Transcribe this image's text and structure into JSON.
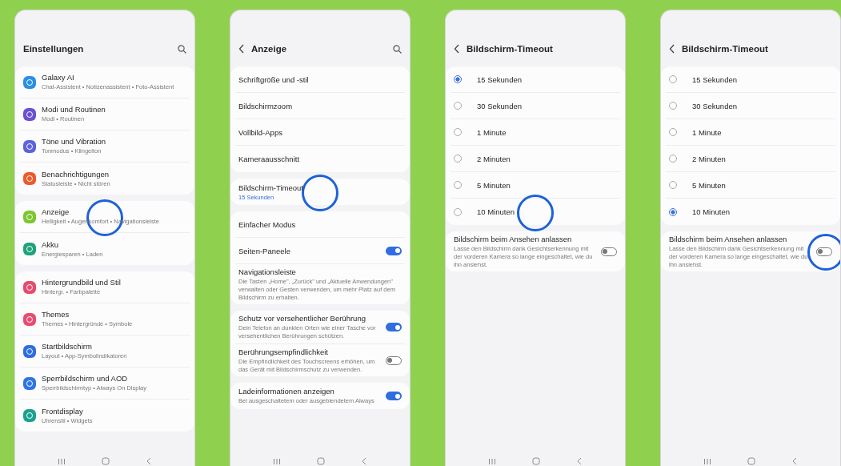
{
  "screens": [
    {
      "header": {
        "title": "Einstellungen",
        "back": false,
        "search": true
      },
      "groups": [
        [
          {
            "kind": "app",
            "color": "#2a8fe8",
            "title": "Galaxy AI",
            "subtitle": "Chat-Assistent • Notizenassistent • Foto-Assistent"
          },
          {
            "kind": "app",
            "color": "#6a4fd8",
            "title": "Modi und Routinen",
            "subtitle": "Modi • Routinen"
          },
          {
            "kind": "app",
            "color": "#5a63e0",
            "title": "Töne und Vibration",
            "subtitle": "Tonmodus • Klingelton"
          },
          {
            "kind": "app",
            "color": "#ee5a2a",
            "title": "Benachrichtigungen",
            "subtitle": "Statusleiste • Nicht stören"
          }
        ],
        [
          {
            "kind": "app",
            "color": "#7cc62e",
            "title": "Anzeige",
            "subtitle": "Helligkeit • Augenkomfort • Navigationsleiste",
            "touched": true
          },
          {
            "kind": "app",
            "color": "#1ea27a",
            "title": "Akku",
            "subtitle": "Energiesparen • Laden"
          }
        ],
        [
          {
            "kind": "app",
            "color": "#e84a6e",
            "title": "Hintergrundbild und Stil",
            "subtitle": "Hintergr. • Farbpalette"
          },
          {
            "kind": "app",
            "color": "#ec4a70",
            "title": "Themes",
            "subtitle": "Themes • Hintergründe • Symbole"
          },
          {
            "kind": "app",
            "color": "#2f6de6",
            "title": "Startbildschirm",
            "subtitle": "Layout • App-Symbolindikatoren"
          },
          {
            "kind": "app",
            "color": "#2f74e8",
            "title": "Sperrbildschirm und AOD",
            "subtitle": "Sperrbildschirmtyp • Always On Display"
          },
          {
            "kind": "app",
            "color": "#1aa290",
            "title": "Frontdisplay",
            "subtitle": "Uhrenstil • Widgets"
          }
        ]
      ]
    },
    {
      "header": {
        "title": "Anzeige",
        "back": true,
        "search": true
      },
      "groups": [
        [
          {
            "kind": "plain",
            "title": "Schriftgröße und -stil"
          },
          {
            "kind": "plain",
            "title": "Bildschirmzoom"
          },
          {
            "kind": "plain",
            "title": "Vollbild-Apps"
          },
          {
            "kind": "plain",
            "title": "Kameraausschnitt"
          }
        ],
        [
          {
            "kind": "plain",
            "title": "Bildschirm-Timeout",
            "value": "15 Sekunden",
            "touched": true
          }
        ],
        [
          {
            "kind": "plain",
            "title": "Einfacher Modus"
          },
          {
            "kind": "toggle",
            "title": "Seiten-Paneele",
            "on": true
          },
          {
            "kind": "plain",
            "title": "Navigationsleiste",
            "subtitle": "Die Tasten „Home\", „Zurück\" und „Aktuelle Anwendungen\" verwalten oder Gesten verwenden, um mehr Platz auf dem Bildschirm zu erhalten."
          }
        ],
        [
          {
            "kind": "toggle",
            "title": "Schutz vor versehentlicher Berührung",
            "subtitle": "Dein Telefon an dunklen Orten wie einer Tasche vor versehentlichen Berührungen schützen.",
            "on": true
          },
          {
            "kind": "toggle",
            "title": "Berührungsempfindlichkeit",
            "subtitle": "Die Empfindlichkeit des Touchscreens erhöhen, um das Gerät mit Bildschirmschutz zu verwenden.",
            "on": false
          }
        ],
        [
          {
            "kind": "toggle",
            "title": "Ladeinformationen anzeigen",
            "subtitle": "Bei ausgeschaltetem oder ausgeblendetem Always",
            "on": true
          }
        ]
      ]
    },
    {
      "header": {
        "title": "Bildschirm-Timeout",
        "back": true,
        "search": false
      },
      "groups": [
        [
          {
            "kind": "radio",
            "title": "15 Sekunden",
            "selected": true
          },
          {
            "kind": "radio",
            "title": "30 Sekunden",
            "selected": false
          },
          {
            "kind": "radio",
            "title": "1 Minute",
            "selected": false
          },
          {
            "kind": "radio",
            "title": "2 Minuten",
            "selected": false
          },
          {
            "kind": "radio",
            "title": "5 Minuten",
            "selected": false
          },
          {
            "kind": "radio",
            "title": "10 Minuten",
            "selected": false,
            "touched": true
          }
        ],
        [
          {
            "kind": "toggle",
            "title": "Bildschirm beim Ansehen anlassen",
            "subtitle": "Lasse den Bildschirm dank Gesichtserkennung mit der vorderen Kamera so lange eingeschaltet, wie du ihn ansiehst.",
            "on": false
          }
        ]
      ]
    },
    {
      "header": {
        "title": "Bildschirm-Timeout",
        "back": true,
        "search": false
      },
      "groups": [
        [
          {
            "kind": "radio",
            "title": "15 Sekunden",
            "selected": false
          },
          {
            "kind": "radio",
            "title": "30 Sekunden",
            "selected": false
          },
          {
            "kind": "radio",
            "title": "1 Minute",
            "selected": false
          },
          {
            "kind": "radio",
            "title": "2 Minuten",
            "selected": false
          },
          {
            "kind": "radio",
            "title": "5 Minuten",
            "selected": false
          },
          {
            "kind": "radio",
            "title": "10 Minuten",
            "selected": true
          }
        ],
        [
          {
            "kind": "toggle",
            "title": "Bildschirm beim Ansehen anlassen",
            "subtitle": "Lasse den Bildschirm dank Gesichtserkennung mit der vorderen Kamera so lange eingeschaltet, wie du ihn ansiehst.",
            "on": false,
            "touched": true
          }
        ]
      ]
    }
  ]
}
